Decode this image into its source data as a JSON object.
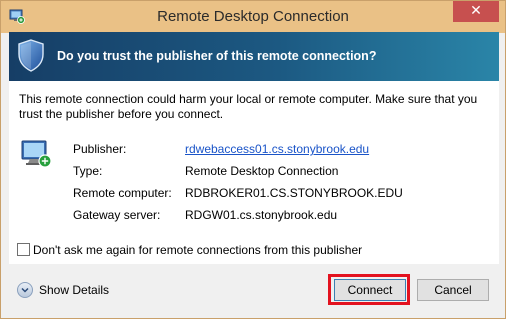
{
  "window": {
    "title": "Remote Desktop Connection",
    "close_glyph": "✕"
  },
  "banner": {
    "heading": "Do you trust the publisher of this remote connection?",
    "icon": "security-shield-icon"
  },
  "warning": {
    "text": "This remote connection could harm your local or remote computer. Make sure that you trust the publisher before you connect."
  },
  "details": {
    "icon": "remote-computer-icon",
    "rows": [
      {
        "label": "Publisher:",
        "value": "rdwebaccess01.cs.stonybrook.edu"
      },
      {
        "label": "Type:",
        "value": "Remote Desktop Connection"
      },
      {
        "label": "Remote computer:",
        "value": "RDBROKER01.CS.STONYBROOK.EDU"
      },
      {
        "label": "Gateway server:",
        "value": "RDGW01.cs.stonybrook.edu"
      }
    ]
  },
  "checkbox": {
    "label": "Don't ask me again for remote connections from this publisher",
    "checked": false
  },
  "footer": {
    "show_details_label": "Show Details",
    "connect_label": "Connect",
    "cancel_label": "Cancel",
    "highlight_color": "#e3121f"
  }
}
